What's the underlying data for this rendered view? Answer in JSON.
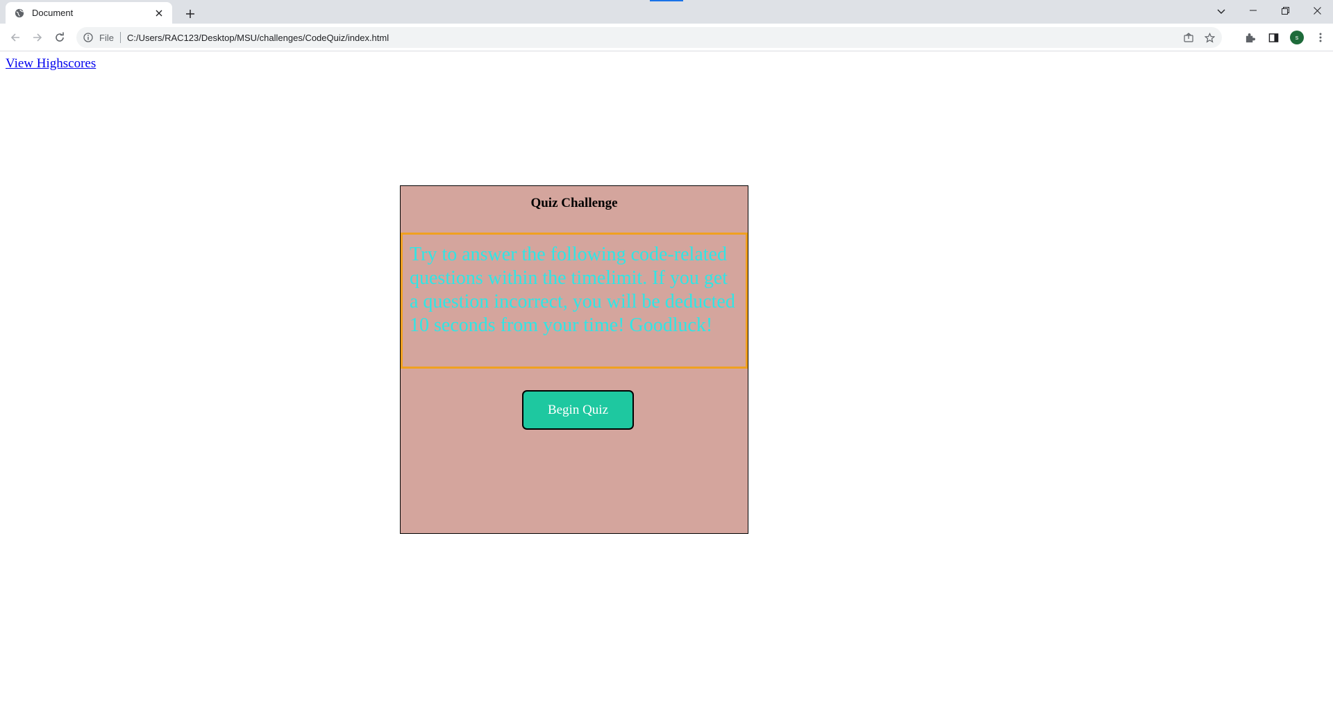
{
  "browser": {
    "tab": {
      "title": "Document",
      "favicon": "globe-icon"
    },
    "address_bar": {
      "scheme_label": "File",
      "url": "C:/Users/RAC123/Desktop/MSU/challenges/CodeQuiz/index.html"
    },
    "profile_initial": "s",
    "accent_color": "#1a73e8"
  },
  "page": {
    "highscores_link": "View Highscores",
    "quiz": {
      "title": "Quiz Challenge",
      "description": "Try to answer the following code-related questions within the timelimit. If you get a question incorrect, you will be deducted 10 seconds from your time! Goodluck!",
      "start_button": "Begin Quiz"
    },
    "colors": {
      "box_background": "#d4a59d",
      "description_border": "#f0a020",
      "description_text": "#2ee6e6",
      "button_background": "#1ec8a0",
      "link": "#0000ee"
    }
  }
}
